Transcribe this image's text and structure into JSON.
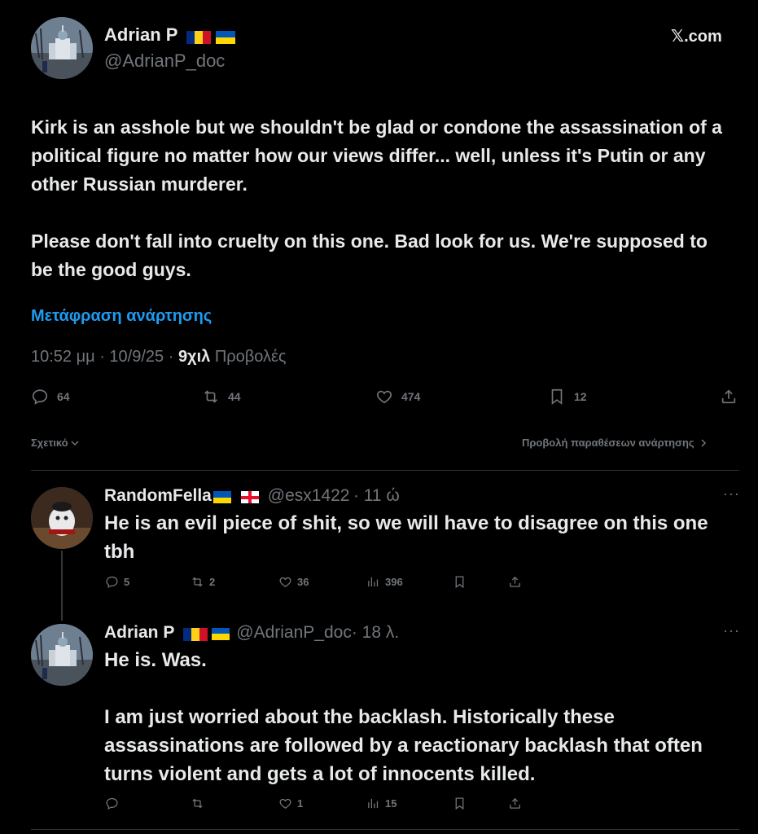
{
  "main_tweet": {
    "author_name": "Adrian P",
    "author_handle": "@AdrianP_doc",
    "source_label": "𝕏.com",
    "text": "Kirk is an asshole but we shouldn't be glad or condone  the assassination of a political figure no matter how our views differ... well, unless it's Putin or any other Russian murderer.\n\nPlease don't fall into cruelty on this one. Bad look for us. We're supposed to be the good guys.",
    "translate_label": "Μετάφραση ανάρτησης",
    "time": "10:52 μμ · 10/9/25 · ",
    "views_count": "9χιλ",
    "views_label": " Προβολές",
    "stats": {
      "replies": "64",
      "reposts": "44",
      "likes": "474",
      "bookmarks": "12"
    },
    "relevance_label": "Σχετικό",
    "quotes_label": "Προβολή παραθέσεων ανάρτησης"
  },
  "replies": [
    {
      "author_name": "RandomFella",
      "author_handle": "@esx1422",
      "time": "· 11 ώ",
      "text": "He is an evil piece of shit, so we will have to disagree on this one tbh",
      "stats": {
        "replies": "5",
        "reposts": "2",
        "likes": "36",
        "views": "396"
      }
    },
    {
      "author_name": "Adrian P",
      "author_handle": "@AdrianP_doc",
      "time": "· 18 λ.",
      "text": "He is. Was.\n\nI am just worried about the backlash. Historically these assassinations are followed by a reactionary backlash that often turns violent and gets a lot of innocents killed.",
      "stats": {
        "replies": "",
        "reposts": "",
        "likes": "1",
        "views": "15"
      }
    }
  ],
  "colors": {
    "background": "#000000",
    "text": "#e7e9ea",
    "muted": "#71767b",
    "accent": "#1d9bf0",
    "divider": "#2f3336"
  },
  "icons": [
    "reply-icon",
    "repost-icon",
    "like-icon",
    "bookmark-icon",
    "share-icon",
    "views-icon",
    "more-icon",
    "chevron-down-icon",
    "chevron-right-icon"
  ]
}
